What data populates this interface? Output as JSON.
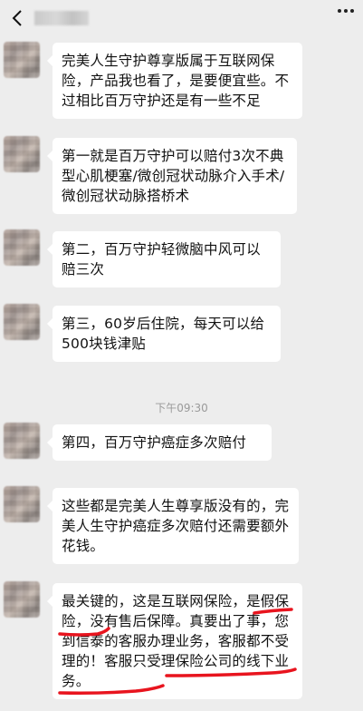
{
  "header": {
    "back_icon": "chevron-left-icon",
    "more_icon": "more-dots-icon"
  },
  "messages": [
    {
      "text": "完美人生守护尊享版属于互联网保险，产品我也看了，是要便宜些。不过相比百万守护还是有一些不足"
    },
    {
      "text": "第一就是百万守护可以赔付3次不典型心肌梗塞/微创冠状动脉介入手术/微创冠状动脉搭桥术"
    },
    {
      "text": "第二，百万守护轻微脑中风可以赔三次"
    },
    {
      "text": "第三，60岁后住院，每天可以给500块钱津贴"
    },
    {
      "text": "第四，百万守护癌症多次赔付"
    },
    {
      "text": "这些都是完美人生尊享版没有的，完美人生守护癌症多次赔付还需要额外花钱。"
    },
    {
      "text": "最关键的，这是互联网保险，是假保险，没有售后保障。真要出了事，您到信泰的客服办理业务，客服都不受理的！客服只受理保险公司的线下业务。"
    }
  ],
  "timestamp": "下午09:30",
  "annotation_color": "#e8141e"
}
